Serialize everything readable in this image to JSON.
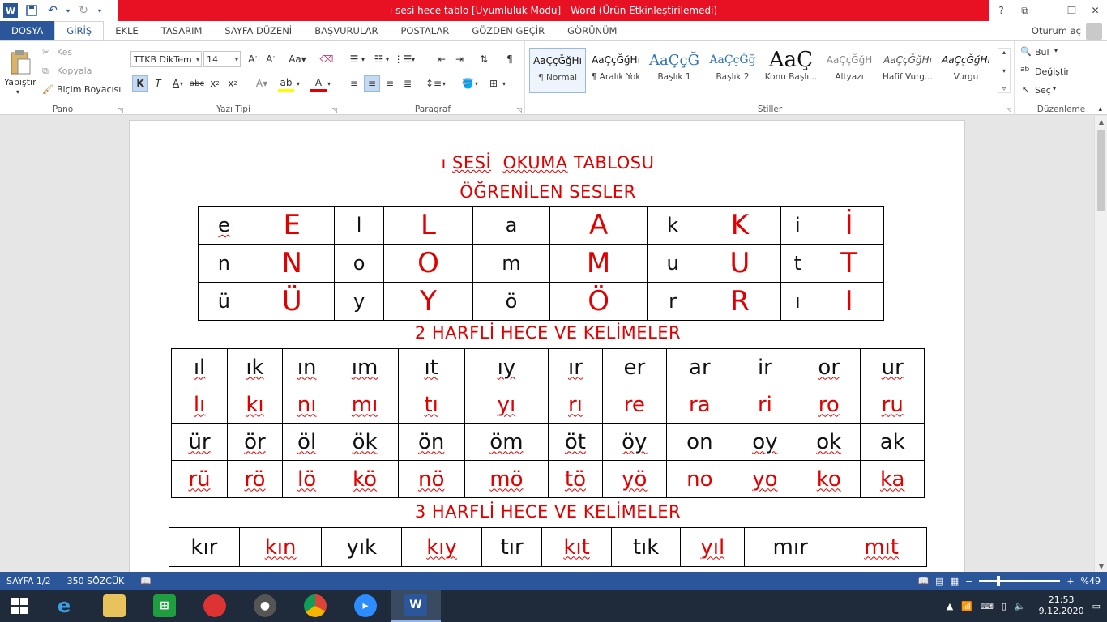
{
  "window": {
    "title": "ı sesi hece tablo [Uyumluluk Modu] -  Word (Ürün Etkinleştirilemedi)",
    "help": "?",
    "controls": [
      "⧉",
      "—",
      "❐",
      "✕"
    ]
  },
  "tabs": [
    "DOSYA",
    "GİRİŞ",
    "EKLE",
    "TASARIM",
    "SAYFA DÜZENİ",
    "BAŞVURULAR",
    "POSTALAR",
    "GÖZDEN GEÇİR",
    "GÖRÜNÜM"
  ],
  "signin": "Oturum aç",
  "clipboard": {
    "paste": "Yapıştır",
    "cut": "Kes",
    "copy": "Kopyala",
    "format_painter": "Biçim Boyacısı",
    "label": "Pano"
  },
  "font": {
    "name": "TTKB DikTem",
    "size": "14",
    "label": "Yazı Tipi"
  },
  "paragraph": {
    "label": "Paragraf"
  },
  "styles": {
    "label": "Stiller",
    "items": [
      {
        "sample": "AaÇçĞğHı",
        "name": "¶ Normal"
      },
      {
        "sample": "AaÇçĞğHı",
        "name": "¶ Aralık Yok"
      },
      {
        "sample": "AaÇçĞ",
        "name": "Başlık 1"
      },
      {
        "sample": "AaÇçĞğ",
        "name": "Başlık 2"
      },
      {
        "sample": "AaÇ",
        "name": "Konu Başlı..."
      },
      {
        "sample": "AaÇçĞğH",
        "name": "Altyazı"
      },
      {
        "sample": "AaÇçĞğHı",
        "name": "Hafif Vurg..."
      },
      {
        "sample": "AaÇçĞğHı",
        "name": "Vurgu"
      }
    ]
  },
  "editing": {
    "find": "Bul",
    "replace": "Değiştir",
    "select": "Seç",
    "label": "Düzenleme"
  },
  "document": {
    "title_prefix": "ı ",
    "title_w1": "SESİ",
    "title_w2": "OKUMA",
    "title_w3": "TABLOSU",
    "subtitle": "ÖĞRENİLEN SESLER",
    "section2": "2 HARFLİ HECE VE KELİMELER",
    "section3": "3 HARFLİ HECE VE KELİMELER",
    "letters_table": [
      [
        "e",
        "E",
        "l",
        "L",
        "a",
        "A",
        "k",
        "K",
        "i",
        "İ"
      ],
      [
        "n",
        "N",
        "o",
        "O",
        "m",
        "M",
        "u",
        "U",
        "t",
        "T"
      ],
      [
        "ü",
        "Ü",
        "y",
        "Y",
        "ö",
        "Ö",
        "r",
        "R",
        "ı",
        "I"
      ]
    ],
    "syllables2": [
      [
        "ıl",
        "ık",
        "ın",
        "ım",
        "ıt",
        "ıy",
        "ır",
        "er",
        "ar",
        "ir",
        "or",
        "ur"
      ],
      [
        "lı",
        "kı",
        "nı",
        "mı",
        "tı",
        "yı",
        "rı",
        "re",
        "ra",
        "ri",
        "ro",
        "ru"
      ],
      [
        "ür",
        "ör",
        "öl",
        "ök",
        "ön",
        "öm",
        "öt",
        "öy",
        "on",
        "oy",
        "ok",
        "ak"
      ],
      [
        "rü",
        "rö",
        "lö",
        "kö",
        "nö",
        "mö",
        "tö",
        "yö",
        "no",
        "yo",
        "ko",
        "ka"
      ]
    ],
    "syllables3": [
      [
        "kır",
        "kın",
        "yık",
        "kıy",
        "tır",
        "kıt",
        "tık",
        "yıl",
        "mır",
        "mıt"
      ]
    ]
  },
  "status": {
    "page": "SAYFA 1/2",
    "words": "350 SÖZCÜK",
    "zoom": "%49"
  },
  "taskbar": {
    "time": "21:53",
    "date": "9.12.2020"
  },
  "colors": {
    "accent": "#2b579a",
    "title_red": "#e81123",
    "doc_red": "#e00000"
  }
}
